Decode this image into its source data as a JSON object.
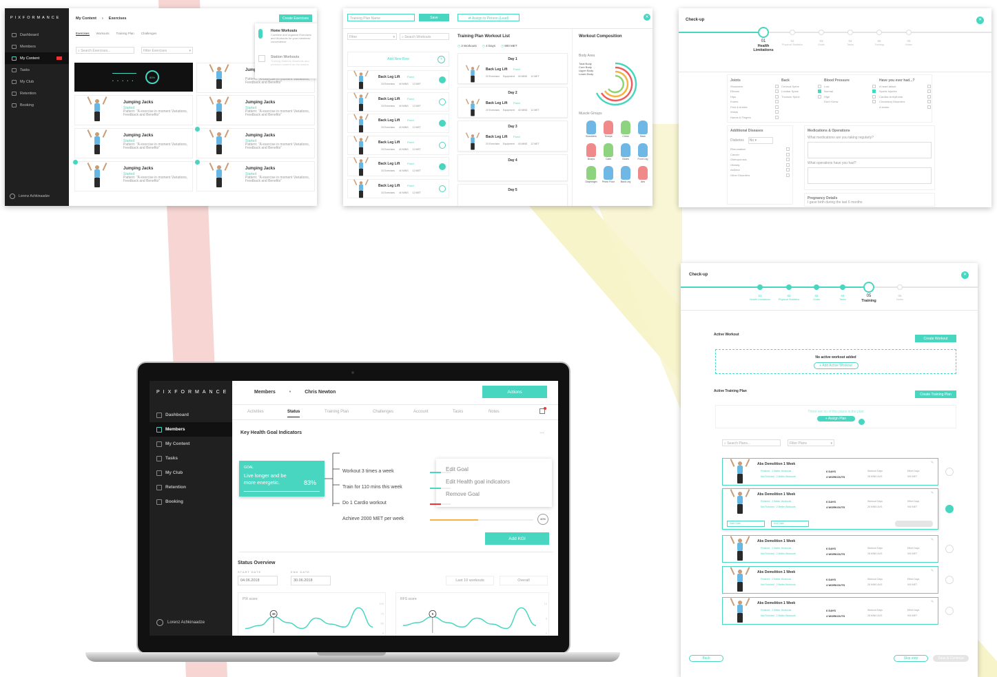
{
  "shot1": {
    "brand": "PIXFORMANCE",
    "sidebar": [
      "Dashboard",
      "Members",
      "My Content",
      "Tasks",
      "My Club",
      "Retention",
      "Booking"
    ],
    "user": "Lorenz Achkinaadze",
    "breadcrumb": [
      "My Content",
      "Exercises"
    ],
    "tabs": [
      "Exercises",
      "Workouts",
      "Training Plan",
      "Challenges"
    ],
    "search_placeholder": "Search Exercises...",
    "filter_placeholder": "Filter Exercises",
    "create_btn": "Create Exercises",
    "dropdown": [
      {
        "title": "Home Workouts",
        "desc": "Combine and organize Exercises and Workouts for your members' convenience"
      },
      {
        "title": "Station Workouts",
        "desc": "Training Stations Workouts and premium content on the station"
      }
    ],
    "cards": [
      {
        "title": "Jumping Jacks",
        "tag": "Started",
        "desc": "Pattern: \"A exercise in moment Variations, Feedback and Benefits\""
      },
      {
        "title": "Jumping Jacks",
        "tag": "Started",
        "desc": "Pattern: \"A exercise in moment Variations, Feedback and Benefits\""
      },
      {
        "title": "Jumping Jacks",
        "tag": "Started",
        "desc": "Pattern: \"A exercise in moment Variations, Feedback and Benefits\""
      },
      {
        "title": "Jumping Jacks",
        "tag": "Started",
        "desc": "Pattern: \"A exercise in moment Variations, Feedback and Benefits\""
      },
      {
        "title": "Jumping Jacks",
        "tag": "Started",
        "desc": "Pattern: \"A exercise in moment Variations, Feedback and Benefits\""
      },
      {
        "title": "Jumping Jacks",
        "tag": "Started",
        "desc": "Pattern: \"A exercise in moment Variations, Feedback and Benefits\""
      },
      {
        "title": "Jump",
        "tag": "",
        "desc": "Pattern: \"A exercise in moment Variations, Feedback and Benefits\""
      }
    ],
    "player_percent": "80%"
  },
  "shot2": {
    "name_placeholder": "Training Plan Name",
    "save_btn": "Save",
    "assign_btn": "Assign to Person (Lead)",
    "filter": "Filter",
    "search": "Search Workouts",
    "add_new": "Add New Row",
    "list_title": "Training Plan Workout List",
    "summary": [
      "3 Workouts",
      "4 Days",
      "900 MET"
    ],
    "composition_title": "Workout Composition",
    "body_area": "Body Area",
    "muscle_groups": "Muscle Groups",
    "legend": [
      "Total Body",
      "Core Body",
      "Upper Body",
      "Lower Body"
    ],
    "muscles": [
      "Shoulders",
      "Triceps",
      "Chest",
      "Back",
      "Biceps",
      "Calfs",
      "Glutes",
      "Front Leg",
      "Diaphragm",
      "Pelvic Floor",
      "Back Leg",
      "Abs"
    ],
    "workout": "Back Leg Lift",
    "workout_tag": "Fixed",
    "meta": [
      "15 Exercises",
      "40 MINS",
      "12 MET"
    ],
    "days": [
      "Day 1",
      "Day 2",
      "Day 3",
      "Day 4",
      "Day 5"
    ],
    "day_meta": [
      "20 Exercises",
      "Equipment",
      "40 MINS",
      "12 MET"
    ]
  },
  "shot3": {
    "title": "Check-up",
    "steps": [
      {
        "num": "01",
        "label": "Health Limitations"
      },
      {
        "num": "02",
        "label": "Physical Statistics"
      },
      {
        "num": "03",
        "label": "Goals"
      },
      {
        "num": "04",
        "label": "Tasks"
      },
      {
        "num": "05",
        "label": "Training"
      },
      {
        "num": "06",
        "label": "Notes"
      }
    ],
    "groups": [
      "Joints",
      "Back",
      "Blood Pressure",
      "Have you ever had...?"
    ],
    "joints": [
      "Shoulders",
      "Elbows",
      "Hips",
      "Knees",
      "Feet & Ankles",
      "Wrists",
      "Hands & Fingers"
    ],
    "back": [
      "Cervical Spine",
      "Lumbar Spine",
      "Thoracic Spine"
    ],
    "bp": [
      "Low",
      "Normal",
      "High",
      "Don't Know"
    ],
    "had": [
      "A heart attack",
      "Sports Injuries",
      "Cardiac Arrhythmia",
      "Circulatory Disorders",
      "A stroke"
    ],
    "additional": "Additional Diseases",
    "diabetes": "Diabetes",
    "diabetes_val": "No",
    "diseases": [
      "Rheumatism",
      "Cancer",
      "Osteoporosis",
      "Obesity",
      "Asthma",
      "Other Disorders"
    ],
    "medications": "Medications & Operations",
    "med_q": "What medications are you taking regularly?",
    "op_q": "What operations have you had?",
    "pregnancy": "Pregnancy Details",
    "preg_q": "I gave birth during the last 6 months"
  },
  "shot4": {
    "title": "Check-up",
    "steps": [
      {
        "num": "01",
        "label": "Health Limitations"
      },
      {
        "num": "02",
        "label": "Physical Statistics"
      },
      {
        "num": "03",
        "label": "Goals"
      },
      {
        "num": "04",
        "label": "Tasks"
      },
      {
        "num": "05",
        "label": "Training"
      },
      {
        "num": "06",
        "label": "Notes"
      }
    ],
    "active_workout": "Active Workout",
    "create_workout": "Create Workout",
    "no_workout": "No active workout added",
    "add_workout": "Add Active Workout",
    "active_plan": "Active Training Plan",
    "create_plan": "Create Training Plan",
    "no_plan": "There are no of this plans in the plan",
    "assign_plan": "Assign Plan",
    "search_plans": "Search Plans...",
    "filter_plans": "Filter Plans",
    "plans": [
      {
        "title": "Abs Demolition 1 Week",
        "t1": "Finished · 2 Better Workouts",
        "t2": "Not Finished · 2 Better Workouts",
        "c1": "6 DAYS",
        "c2": "4 WORKOUTS",
        "m1": "Workout Days",
        "m2": "28 MINS AVG",
        "e1": "Effort Days",
        "e2": "900 MET"
      },
      {
        "title": "Abs Demolition 1 Week",
        "t1": "Finished · 2 Better Workouts",
        "t2": "Not Finished · 2 Better Workouts",
        "c1": "6 DAYS",
        "c2": "4 WORKOUTS",
        "m1": "Workout Days",
        "m2": "28 MINS AVG",
        "e1": "Effort Days",
        "e2": "900 MET"
      },
      {
        "title": "Abs Demolition 1 Week",
        "t1": "Finished · 2 Better Workouts",
        "t2": "Not Finished · 2 Better Workouts",
        "c1": "6 DAYS",
        "c2": "4 WORKOUTS",
        "m1": "Workout Days",
        "m2": "28 MINS AVG",
        "e1": "Effort Days",
        "e2": "900 MET"
      },
      {
        "title": "Abs Demolition 1 Week",
        "t1": "Finished · 2 Better Workouts",
        "t2": "Not Finished · 2 Better Workouts",
        "c1": "6 DAYS",
        "c2": "4 WORKOUTS",
        "m1": "Workout Days",
        "m2": "28 MINS AVG",
        "e1": "Effort Days",
        "e2": "900 MET"
      },
      {
        "title": "Abs Demolition 1 Week",
        "t1": "Finished · 2 Better Workouts",
        "t2": "Not Finished · 2 Better Workouts",
        "c1": "6 DAYS",
        "c2": "4 WORKOUTS",
        "m1": "Workout Days",
        "m2": "28 MINS AVG",
        "e1": "Effort Days",
        "e2": "900 MET"
      }
    ],
    "start_date": "Start Date",
    "end_date": "End Date",
    "back": "Back",
    "skip": "Skip step",
    "save_continue": "Save & Continue"
  },
  "laptop": {
    "brand": "PIXFORMANCE",
    "sidebar": [
      "Dashboard",
      "Members",
      "My Content",
      "Tasks",
      "My Club",
      "Retention",
      "Booking"
    ],
    "user": "Lorenz Achkinaadze",
    "breadcrumb": [
      "Members",
      "Chris Newton"
    ],
    "actions_btn": "Actions",
    "tabs": [
      "Activities",
      "Status",
      "Training Plan",
      "Challenges",
      "Account",
      "Tasks",
      "Notes"
    ],
    "section_title": "Key Health Goal Indicators",
    "goal_label": "GOAL",
    "goal_text": "Live longer and be more energetic.",
    "goal_percent": "83%",
    "kpis": [
      "Workout 3 times a week",
      "Train for 110 mins this week",
      "Do 1 Cardio workout",
      "Achieve 2000 MET per week"
    ],
    "kpi_badge": "40%",
    "menu": [
      "Edit Goal",
      "Edit Health goal indicators",
      "Remove Goal"
    ],
    "add_kpi": "Add KGI",
    "overview_title": "Status Overview",
    "start_label": "START DATE",
    "end_label": "END DATE",
    "start_date": "04.06.2018",
    "end_date": "30.06.2018",
    "filter1": "Last 10 workouts",
    "filter2": "Overall",
    "charts": [
      {
        "title": "PIX score",
        "marker": "48",
        "ticks": [
          "04",
          "06",
          "08",
          "10",
          "14",
          "18",
          "21",
          "24",
          "27",
          "30"
        ],
        "yticks": [
          "100",
          "75",
          "50",
          "0"
        ]
      },
      {
        "title": "RFS score",
        "marker": "5",
        "ticks": [
          "04",
          "06",
          "08",
          "10",
          "14",
          "18",
          "21",
          "24",
          "27",
          "30"
        ],
        "yticks": [
          "10",
          "5",
          "0"
        ]
      }
    ]
  },
  "colors": {
    "accent": "#48d6c0",
    "dark": "#202020",
    "stripe_red": "#f4d3d3",
    "stripe_yellow": "#f6f3c7"
  }
}
